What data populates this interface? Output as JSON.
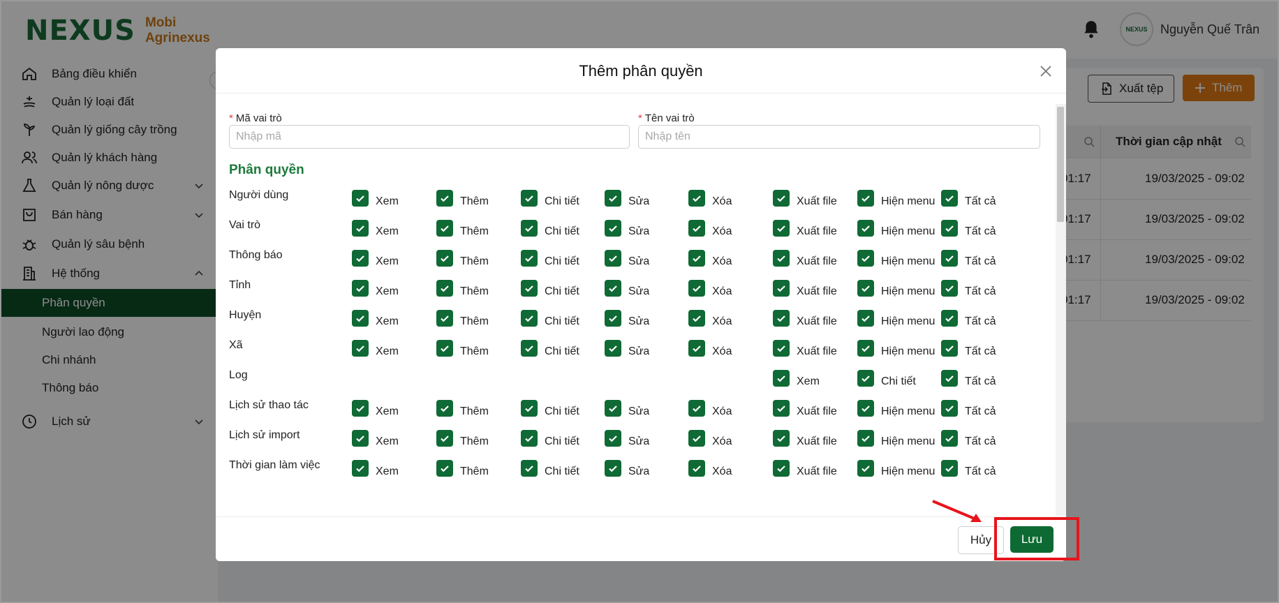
{
  "header": {
    "logo_text": "NEXUS",
    "logo_sub_line1": "Mobi",
    "logo_sub_line2": "Agrinexus",
    "avatar_text": "NEXUS",
    "user_name": "Nguyễn Quế Trân"
  },
  "sidebar": {
    "items": [
      {
        "label": "Bảng điều khiển",
        "icon": "home-icon"
      },
      {
        "label": "Quản lý loại đất",
        "icon": "soil-icon"
      },
      {
        "label": "Quản lý giống cây trồng",
        "icon": "plant-icon"
      },
      {
        "label": "Quản lý khách hàng",
        "icon": "users-icon"
      },
      {
        "label": "Quản lý nông dược",
        "icon": "flask-icon"
      },
      {
        "label": "Bán hàng",
        "icon": "shopping-bag-icon"
      },
      {
        "label": "Quản lý sâu bệnh",
        "icon": "bug-icon"
      },
      {
        "label": "Hệ thống",
        "icon": "building-icon"
      },
      {
        "label": "Lịch sử",
        "icon": "clock-icon"
      }
    ],
    "sub_items": [
      {
        "label": "Phân quyền",
        "active": true
      },
      {
        "label": "Người lao động"
      },
      {
        "label": "Chi nhánh"
      },
      {
        "label": "Thông báo"
      }
    ]
  },
  "content": {
    "export_label": "Xuất tệp",
    "add_label": "Thêm",
    "column_updated": "Thời gian cập nhật",
    "rows": [
      {
        "time_fragment": "01:17",
        "updated": "19/03/2025 - 09:02"
      },
      {
        "time_fragment": "01:17",
        "updated": "19/03/2025 - 09:02"
      },
      {
        "time_fragment": "01:17",
        "updated": "19/03/2025 - 09:02"
      },
      {
        "time_fragment": "01:17",
        "updated": "19/03/2025 - 09:02"
      }
    ]
  },
  "modal": {
    "title": "Thêm phân quyền",
    "role_code_label": "Mã vai trò",
    "role_code_placeholder": "Nhập mã",
    "role_name_label": "Tên vai trò",
    "role_name_placeholder": "Nhập tên",
    "section_title": "Phân quyền",
    "cancel_label": "Hủy",
    "save_label": "Lưu"
  },
  "permissions": [
    {
      "name": "Người dùng",
      "options": [
        "Xem",
        "Thêm",
        "Chi tiết",
        "Sửa",
        "Xóa",
        "Xuất file",
        "Hiện menu",
        "Tất cả"
      ]
    },
    {
      "name": "Vai trò",
      "options": [
        "Xem",
        "Thêm",
        "Chi tiết",
        "Sửa",
        "Xóa",
        "Xuất file",
        "Hiện menu",
        "Tất cả"
      ]
    },
    {
      "name": "Thông báo",
      "options": [
        "Xem",
        "Thêm",
        "Chi tiết",
        "Sửa",
        "Xóa",
        "Xuất file",
        "Hiện menu",
        "Tất cả"
      ]
    },
    {
      "name": "Tỉnh",
      "options": [
        "Xem",
        "Thêm",
        "Chi tiết",
        "Sửa",
        "Xóa",
        "Xuất file",
        "Hiện menu",
        "Tất cả"
      ]
    },
    {
      "name": "Huyện",
      "options": [
        "Xem",
        "Thêm",
        "Chi tiết",
        "Sửa",
        "Xóa",
        "Xuất file",
        "Hiện menu",
        "Tất cả"
      ]
    },
    {
      "name": "Xã",
      "options": [
        "Xem",
        "Thêm",
        "Chi tiết",
        "Sửa",
        "Xóa",
        "Xuất file",
        "Hiện menu",
        "Tất cả"
      ]
    },
    {
      "name": "Log",
      "options": [
        "Xem",
        "Chi tiết",
        "Tất cả"
      ]
    },
    {
      "name": "Lịch sử thao tác",
      "options": [
        "Xem",
        "Thêm",
        "Chi tiết",
        "Sửa",
        "Xóa",
        "Xuất file",
        "Hiện menu",
        "Tất cả"
      ]
    },
    {
      "name": "Lịch sử import",
      "options": [
        "Xem",
        "Thêm",
        "Chi tiết",
        "Sửa",
        "Xóa",
        "Xuất file",
        "Hiện menu",
        "Tất cả"
      ]
    },
    {
      "name": "Thời gian làm việc",
      "options": [
        "Xem",
        "Thêm",
        "Chi tiết",
        "Sửa",
        "Xóa",
        "Xuất file",
        "Hiện menu",
        "Tất cả"
      ]
    }
  ],
  "colors": {
    "brand_green": "#0e6a33",
    "brand_orange": "#e07b14",
    "highlight_red": "#e8141c"
  }
}
